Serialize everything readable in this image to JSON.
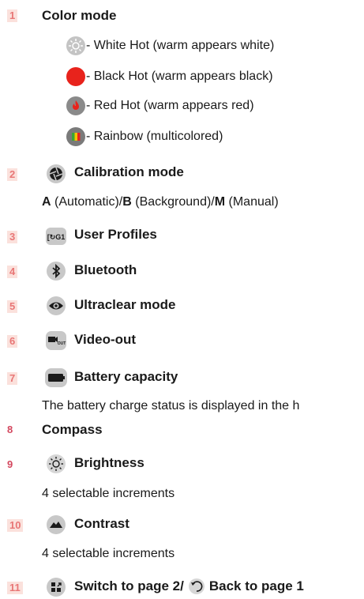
{
  "items": [
    {
      "num": "1",
      "title": "Color mode"
    },
    {
      "num": "2",
      "title": "Calibration mode"
    },
    {
      "num": "3",
      "title": "User Profiles"
    },
    {
      "num": "4",
      "title": "Bluetooth"
    },
    {
      "num": "5",
      "title": "Ultraclear mode"
    },
    {
      "num": "6",
      "title": "Video-out"
    },
    {
      "num": "7",
      "title": "Battery capacity"
    },
    {
      "num": "8",
      "title": "Compass"
    },
    {
      "num": "9",
      "title": "Brightness"
    },
    {
      "num": "10",
      "title": "Contrast"
    },
    {
      "num": "11",
      "title_a": "Switch to page 2/",
      "title_b": "Back to page 1"
    }
  ],
  "color_modes": [
    {
      "label": "- White Hot (warm appears white)",
      "icon": "white-hot-icon",
      "color": "#b9b9b9"
    },
    {
      "label": "- Black Hot (warm appears black)",
      "icon": "black-hot-icon",
      "color": "#e8231c"
    },
    {
      "label": "- Red Hot (warm appears red)",
      "icon": "red-hot-icon",
      "color": "#8a8a8a"
    },
    {
      "label": "- Rainbow (multicolored)",
      "icon": "rainbow-icon",
      "color": "#7a7a7a"
    }
  ],
  "calibration": {
    "a_letter": "A",
    "a_text": " (Automatic)/",
    "b_letter": "B",
    "b_text": " (Background)/",
    "m_letter": "M",
    "m_text": " (Manual)"
  },
  "battery_desc": "The battery charge status is displayed in the h",
  "brightness_desc": "4 selectable increments",
  "contrast_desc": "4 selectable increments",
  "colors": {
    "number_text": "#e87676",
    "number_bg": "#fbe1dc",
    "icon_gray": "#c8c8c8",
    "icon_dark": "#1a1a1a"
  }
}
